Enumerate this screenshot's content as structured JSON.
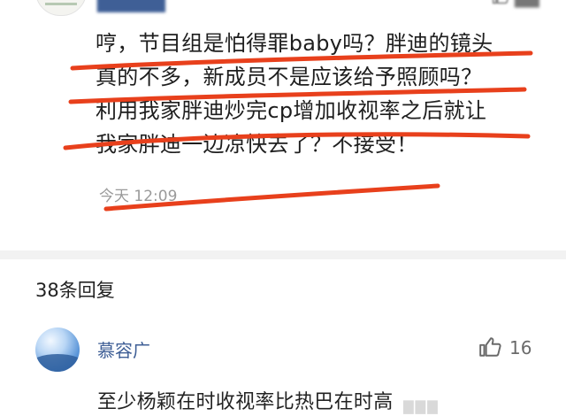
{
  "top_comment": {
    "avatar_icon": "avatar-icon",
    "like_icon": "thumbs-up-icon",
    "lines": [
      "哼，节目组是怕得罪baby吗？胖迪的镜头",
      "真的不多，新成员不是应该给予照顾吗？",
      "利用我家胖迪炒完cp增加收视率之后就让",
      "我家胖迪一边凉快去了？不接受！"
    ],
    "time": "今天 12:09"
  },
  "replies": {
    "count_label": "38条回复"
  },
  "reply": {
    "avatar_icon": "avatar-icon",
    "username": "慕容广",
    "like_icon": "thumbs-up-icon",
    "like_count": "16",
    "text": "至少杨颖在时收视率比热巴在时高"
  },
  "colors": {
    "username": "#3f5f96",
    "annotation_stroke": "#e8401c",
    "time": "#9a9a9a",
    "like_count": "#6a6a6a"
  }
}
